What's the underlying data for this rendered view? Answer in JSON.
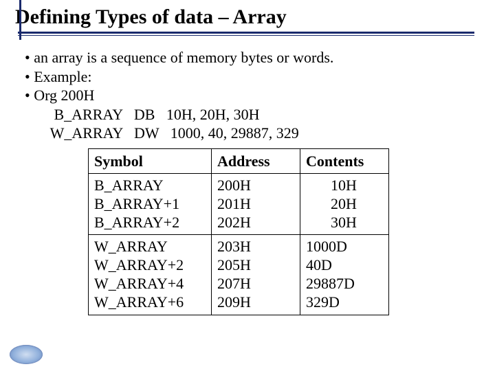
{
  "title": "Defining Types of data – Array",
  "bullets": {
    "b1": "• an array is a sequence of memory bytes or words.",
    "b2": "• Example:",
    "b3": "• Org 200H",
    "b4": "   B_ARRAY   DB   10H, 20H, 30H",
    "b5": "  W_ARRAY   DW   1000, 40, 29887, 329"
  },
  "table": {
    "headers": {
      "symbol": "Symbol",
      "address": "Address",
      "contents": "Contents"
    },
    "row1": {
      "sym": [
        "B_ARRAY",
        "B_ARRAY+1",
        "B_ARRAY+2"
      ],
      "addr": [
        "200H",
        "201H",
        "202H"
      ],
      "cont": [
        "10H",
        "20H",
        "30H"
      ]
    },
    "row2": {
      "sym": [
        "W_ARRAY",
        "W_ARRAY+2",
        "W_ARRAY+4",
        "W_ARRAY+6"
      ],
      "addr": [
        "203H",
        "205H",
        "207H",
        "209H"
      ],
      "cont": [
        "1000D",
        "40D",
        "29887D",
        "329D"
      ]
    }
  }
}
